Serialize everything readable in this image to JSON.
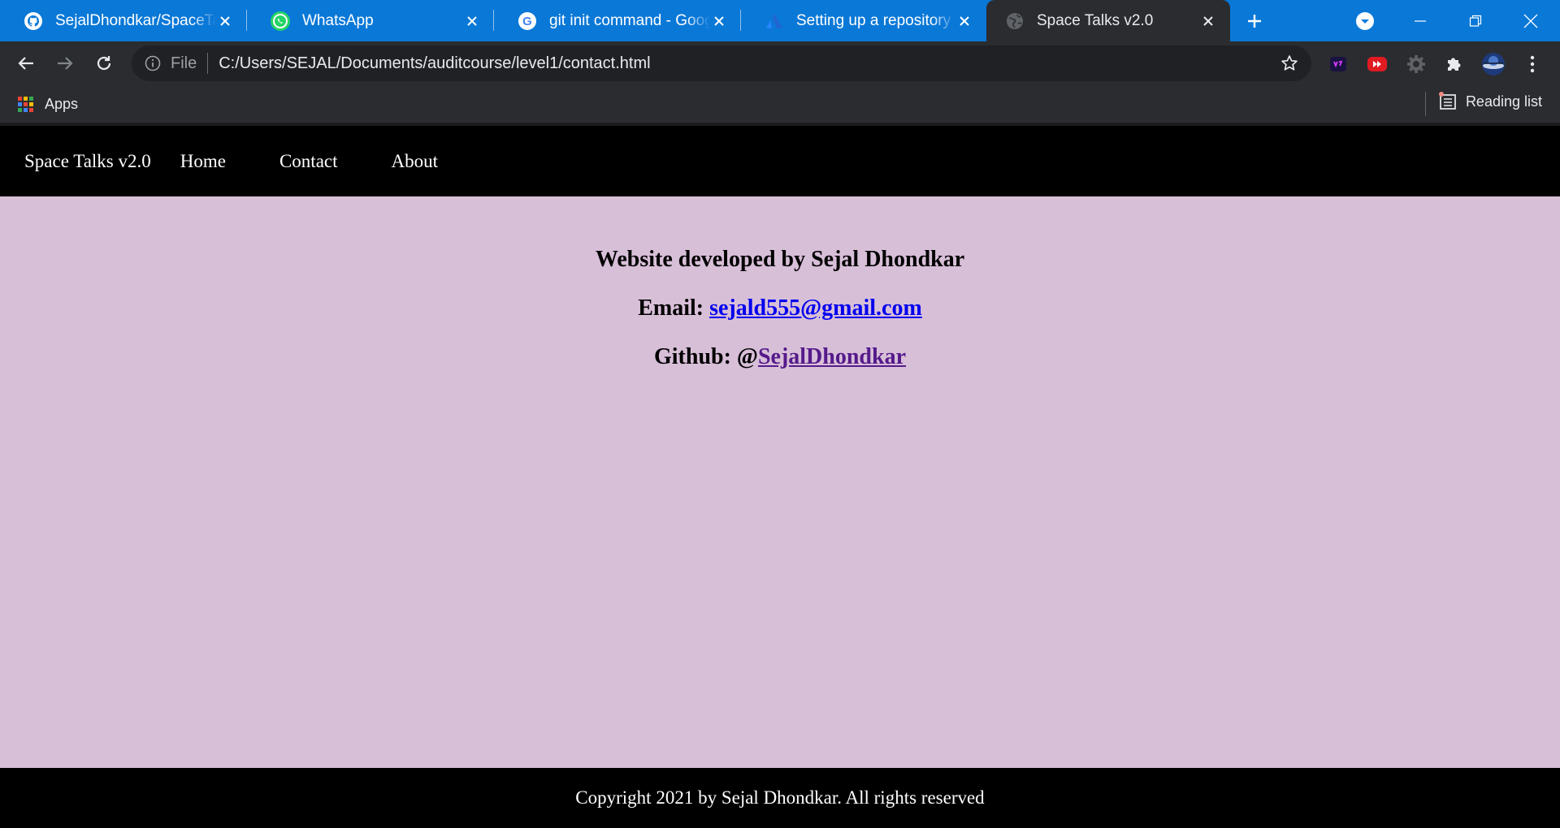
{
  "browser": {
    "tabs": [
      {
        "title": "SejalDhondkar/SpaceTalks",
        "favicon": "github-icon"
      },
      {
        "title": "WhatsApp",
        "favicon": "whatsapp-icon"
      },
      {
        "title": "git init command - Google",
        "favicon": "google-icon"
      },
      {
        "title": "Setting up a repository | A",
        "favicon": "atlassian-icon"
      },
      {
        "title": "Space Talks v2.0",
        "favicon": "globe-icon",
        "active": true
      }
    ],
    "address": {
      "scheme_label": "File",
      "url": "C:/Users/SEJAL/Documents/auditcourse/level1/contact.html"
    },
    "bookmarks": {
      "apps_label": "Apps",
      "reading_list_label": "Reading list"
    }
  },
  "site": {
    "brand": "Space Talks v2.0",
    "nav": {
      "home": "Home",
      "contact": "Contact",
      "about": "About"
    },
    "contact": {
      "developer_line": "Website developed by Sejal Dhondkar",
      "email_label": "Email:",
      "email_value": "sejald555@gmail.com",
      "github_label": "Github: @",
      "github_value": "SejalDhondkar"
    },
    "footer": "Copyright 2021 by Sejal Dhondkar. All rights reserved"
  },
  "colors": {
    "page_background": "#d8bfd8",
    "nav_background": "#000000",
    "tabstrip": "#0a78d7",
    "link": "#0000ee",
    "visited_link": "#551a8b"
  }
}
